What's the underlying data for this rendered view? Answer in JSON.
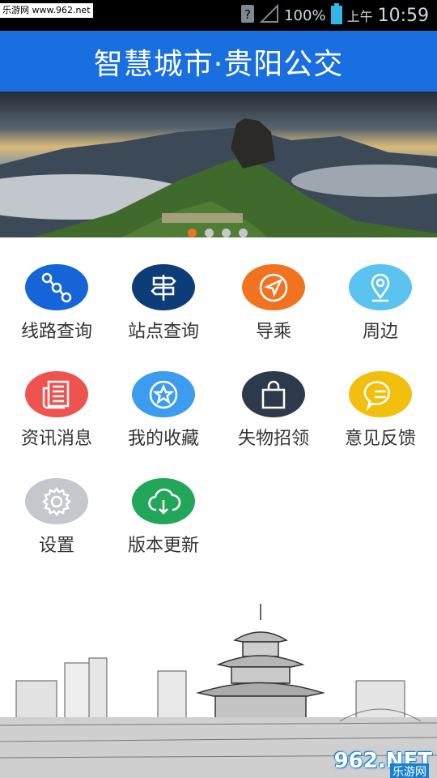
{
  "status_bar": {
    "watermark": "乐游网 www.962.net",
    "battery": "100%",
    "ampm": "上午",
    "time": "10:59"
  },
  "header": {
    "title": "智慧城市·贵阳公交"
  },
  "banner": {
    "page_count": 4,
    "active_index": 0
  },
  "menu": {
    "items": [
      {
        "label": "线路查询",
        "icon": "route-icon",
        "color": "#1565d8"
      },
      {
        "label": "站点查询",
        "icon": "signpost-icon",
        "color": "#0d3d78"
      },
      {
        "label": "导乘",
        "icon": "navigation-arrow-icon",
        "color": "#f2731f"
      },
      {
        "label": "周边",
        "icon": "location-pin-icon",
        "color": "#5bc3f0"
      },
      {
        "label": "资讯消息",
        "icon": "newspaper-icon",
        "color": "#ef5350"
      },
      {
        "label": "我的收藏",
        "icon": "star-icon",
        "color": "#3c9cf0"
      },
      {
        "label": "失物招领",
        "icon": "shopping-bag-icon",
        "color": "#2e3a4c"
      },
      {
        "label": "意见反馈",
        "icon": "chat-bubble-icon",
        "color": "#f2bf0e"
      },
      {
        "label": "设置",
        "icon": "gear-icon",
        "color": "#c4c7cc"
      },
      {
        "label": "版本更新",
        "icon": "cloud-download-icon",
        "color": "#22a75a"
      }
    ]
  },
  "footer_watermark": {
    "logo_text": "962.NET",
    "sub_text": "乐游网"
  }
}
